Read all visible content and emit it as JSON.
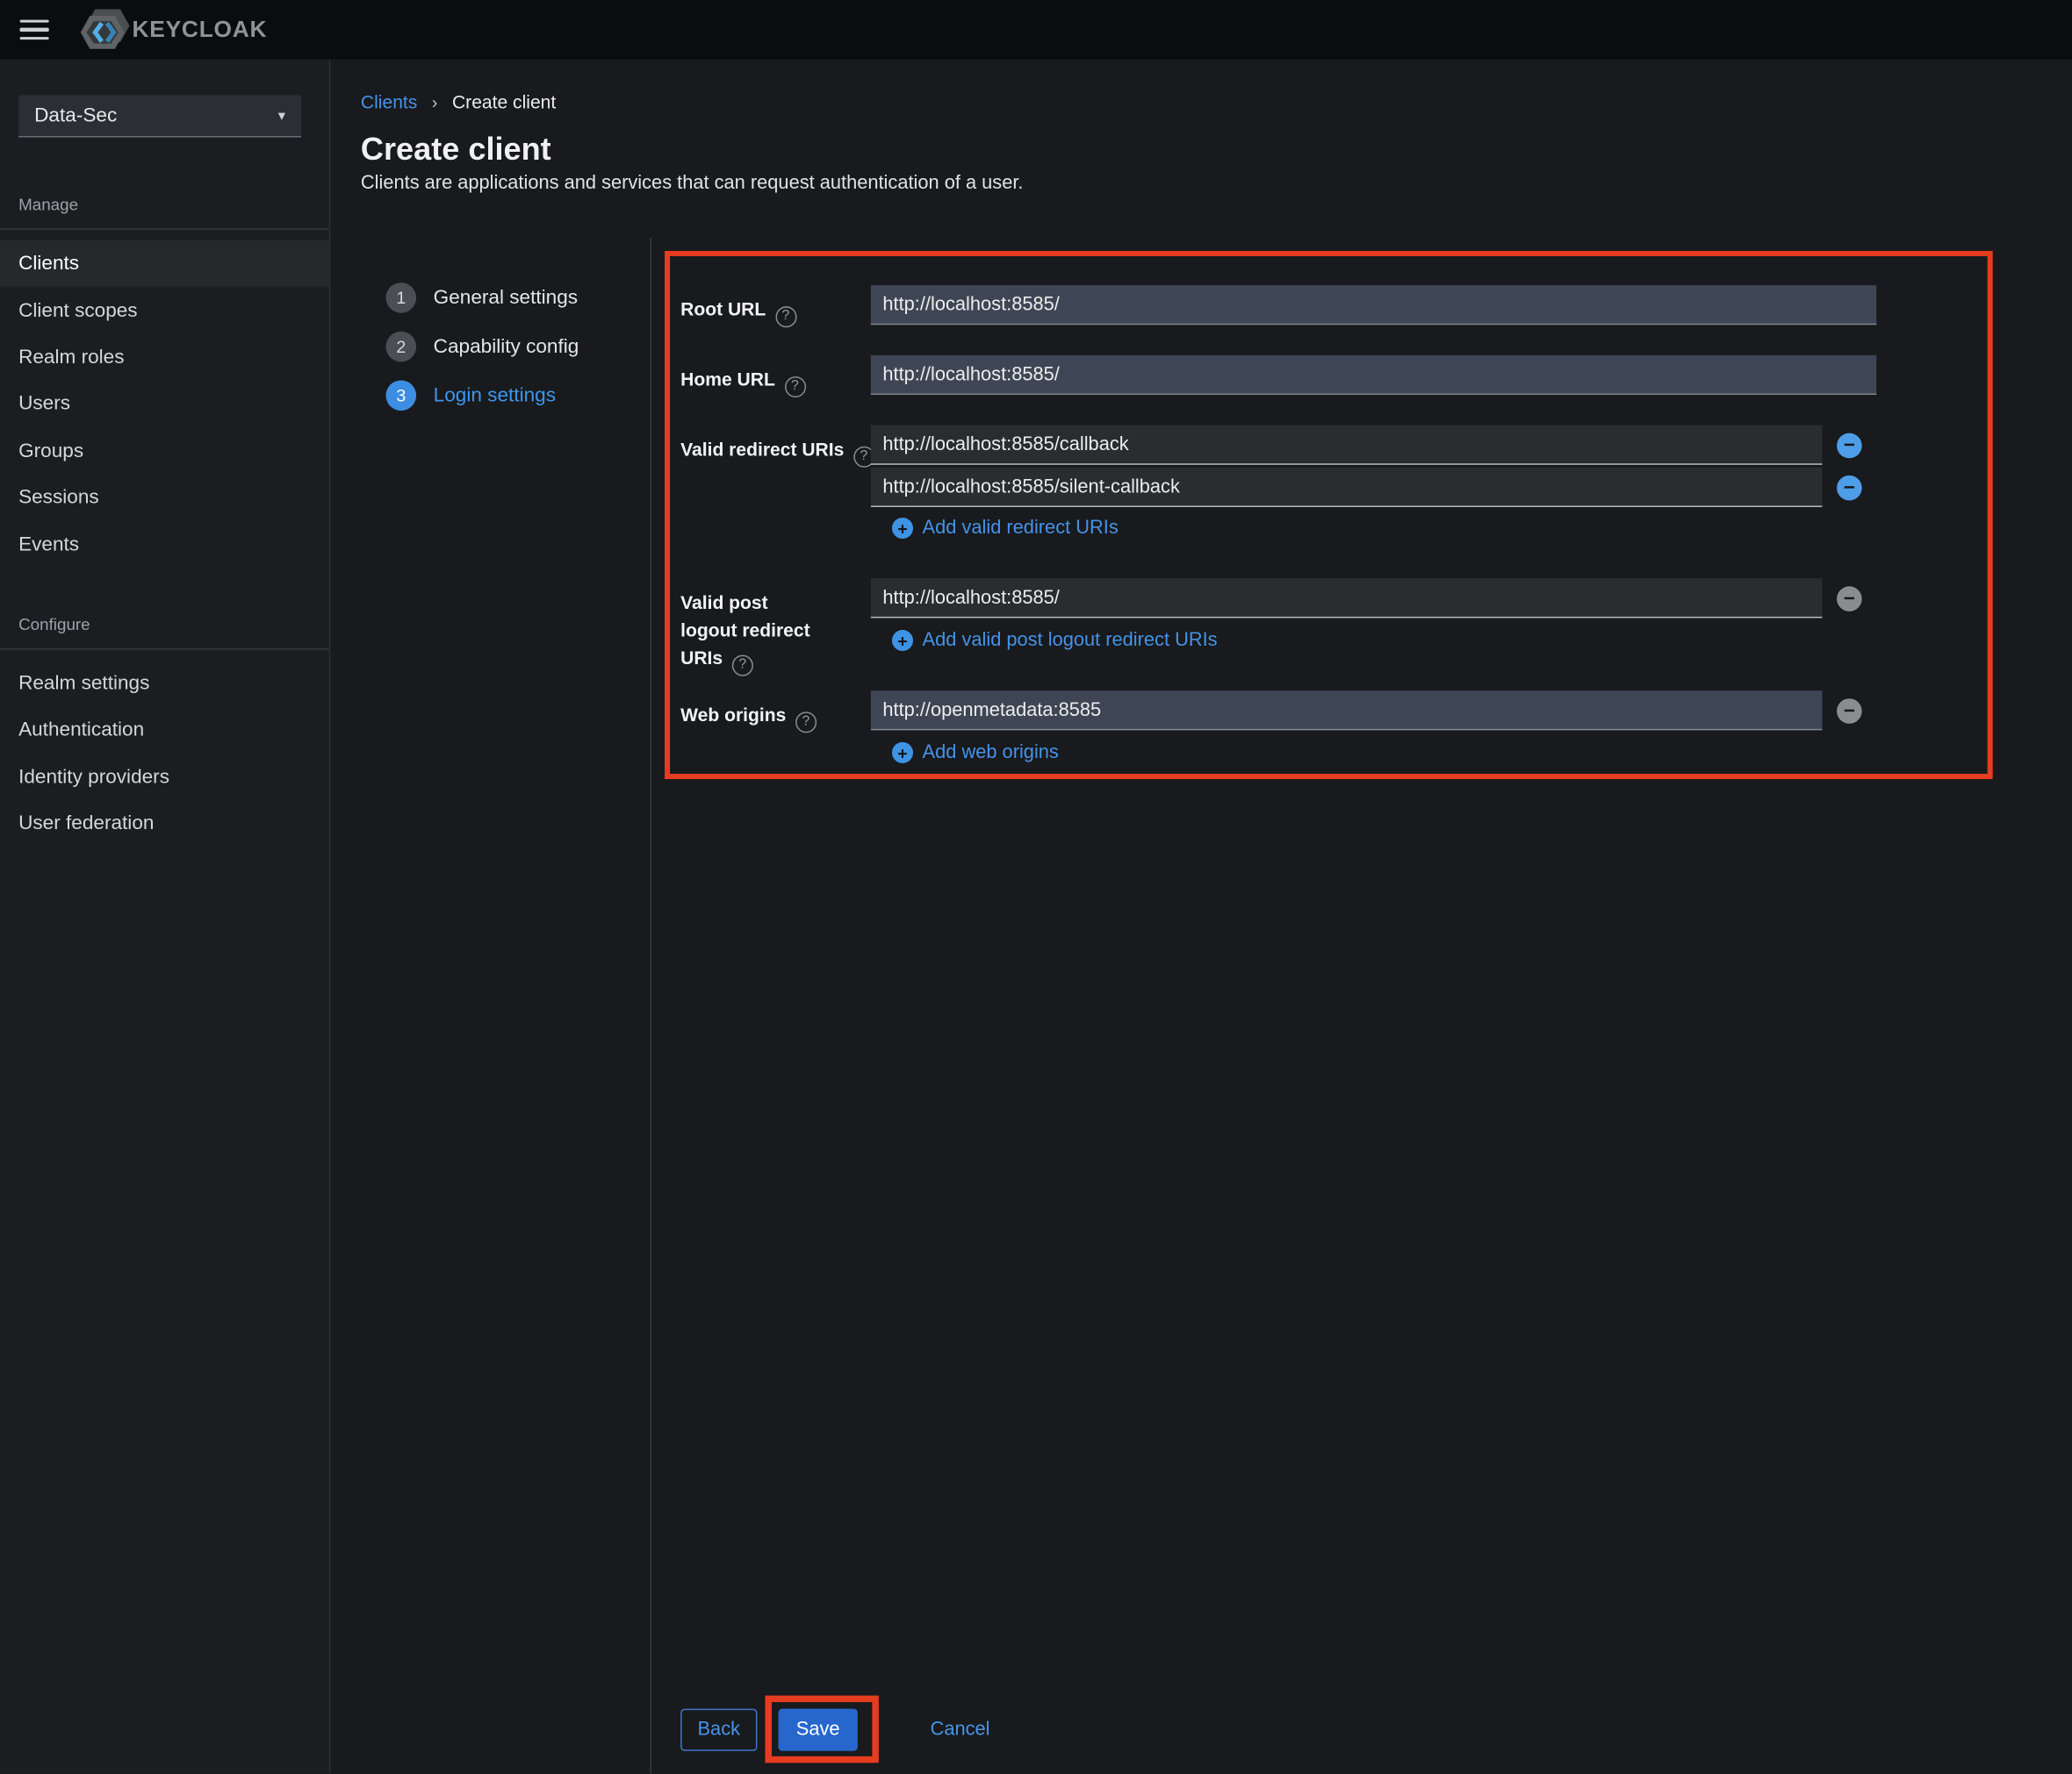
{
  "colors": {
    "topbar_bg": "#0b0c0d",
    "sidebar_bg": "#1b1d21",
    "main_bg": "#181a1d",
    "accent_link": "#4593e8",
    "active_step": "#3d8ee2",
    "save_bg": "#2767cd",
    "input_light_bg": "#3e4655",
    "input_dark_bg": "#2a2c2f",
    "annotation_red": "#e63c20",
    "minus_blue": "#4e9de8",
    "minus_gray": "#8a8d90"
  },
  "icons": {
    "chevron_down": "▾",
    "breadcrumb_chevron": "›",
    "help": "?",
    "minus_circle": "−",
    "plus_circle": "+"
  },
  "topbar": {
    "brand": "KEYCLOAK"
  },
  "sidebar": {
    "realm": "Data-Sec",
    "sections": [
      {
        "label": "Manage",
        "items": [
          {
            "label": "Clients"
          },
          {
            "label": "Client scopes"
          },
          {
            "label": "Realm roles"
          },
          {
            "label": "Users"
          },
          {
            "label": "Groups"
          },
          {
            "label": "Sessions"
          },
          {
            "label": "Events"
          }
        ]
      },
      {
        "label": "Configure",
        "items": [
          {
            "label": "Realm settings"
          },
          {
            "label": "Authentication"
          },
          {
            "label": "Identity providers"
          },
          {
            "label": "User federation"
          }
        ]
      }
    ]
  },
  "breadcrumb": {
    "link": "Clients",
    "current": "Create client"
  },
  "page": {
    "title": "Create client",
    "subtitle": "Clients are applications and services that can request authentication of a user."
  },
  "wizard": {
    "steps": [
      {
        "number": "1",
        "label": "General settings"
      },
      {
        "number": "2",
        "label": "Capability config"
      },
      {
        "number": "3",
        "label": "Login settings"
      }
    ]
  },
  "form": {
    "rows": [
      {
        "label": "Root URL",
        "values": [
          "http://localhost:8585/"
        ]
      },
      {
        "label": "Home URL",
        "values": [
          "http://localhost:8585/"
        ]
      },
      {
        "label": "Valid redirect URIs",
        "values": [
          "http://localhost:8585/callback",
          "http://localhost:8585/silent-callback"
        ],
        "add_label": "Add valid redirect URIs"
      },
      {
        "label": "Valid post logout redirect URIs",
        "values": [
          "http://localhost:8585/"
        ],
        "add_label": "Add valid post logout redirect URIs"
      },
      {
        "label": "Web origins",
        "values": [
          "http://openmetadata:8585"
        ],
        "add_label": "Add web origins"
      }
    ]
  },
  "footer": {
    "back": "Back",
    "save": "Save",
    "cancel": "Cancel"
  }
}
